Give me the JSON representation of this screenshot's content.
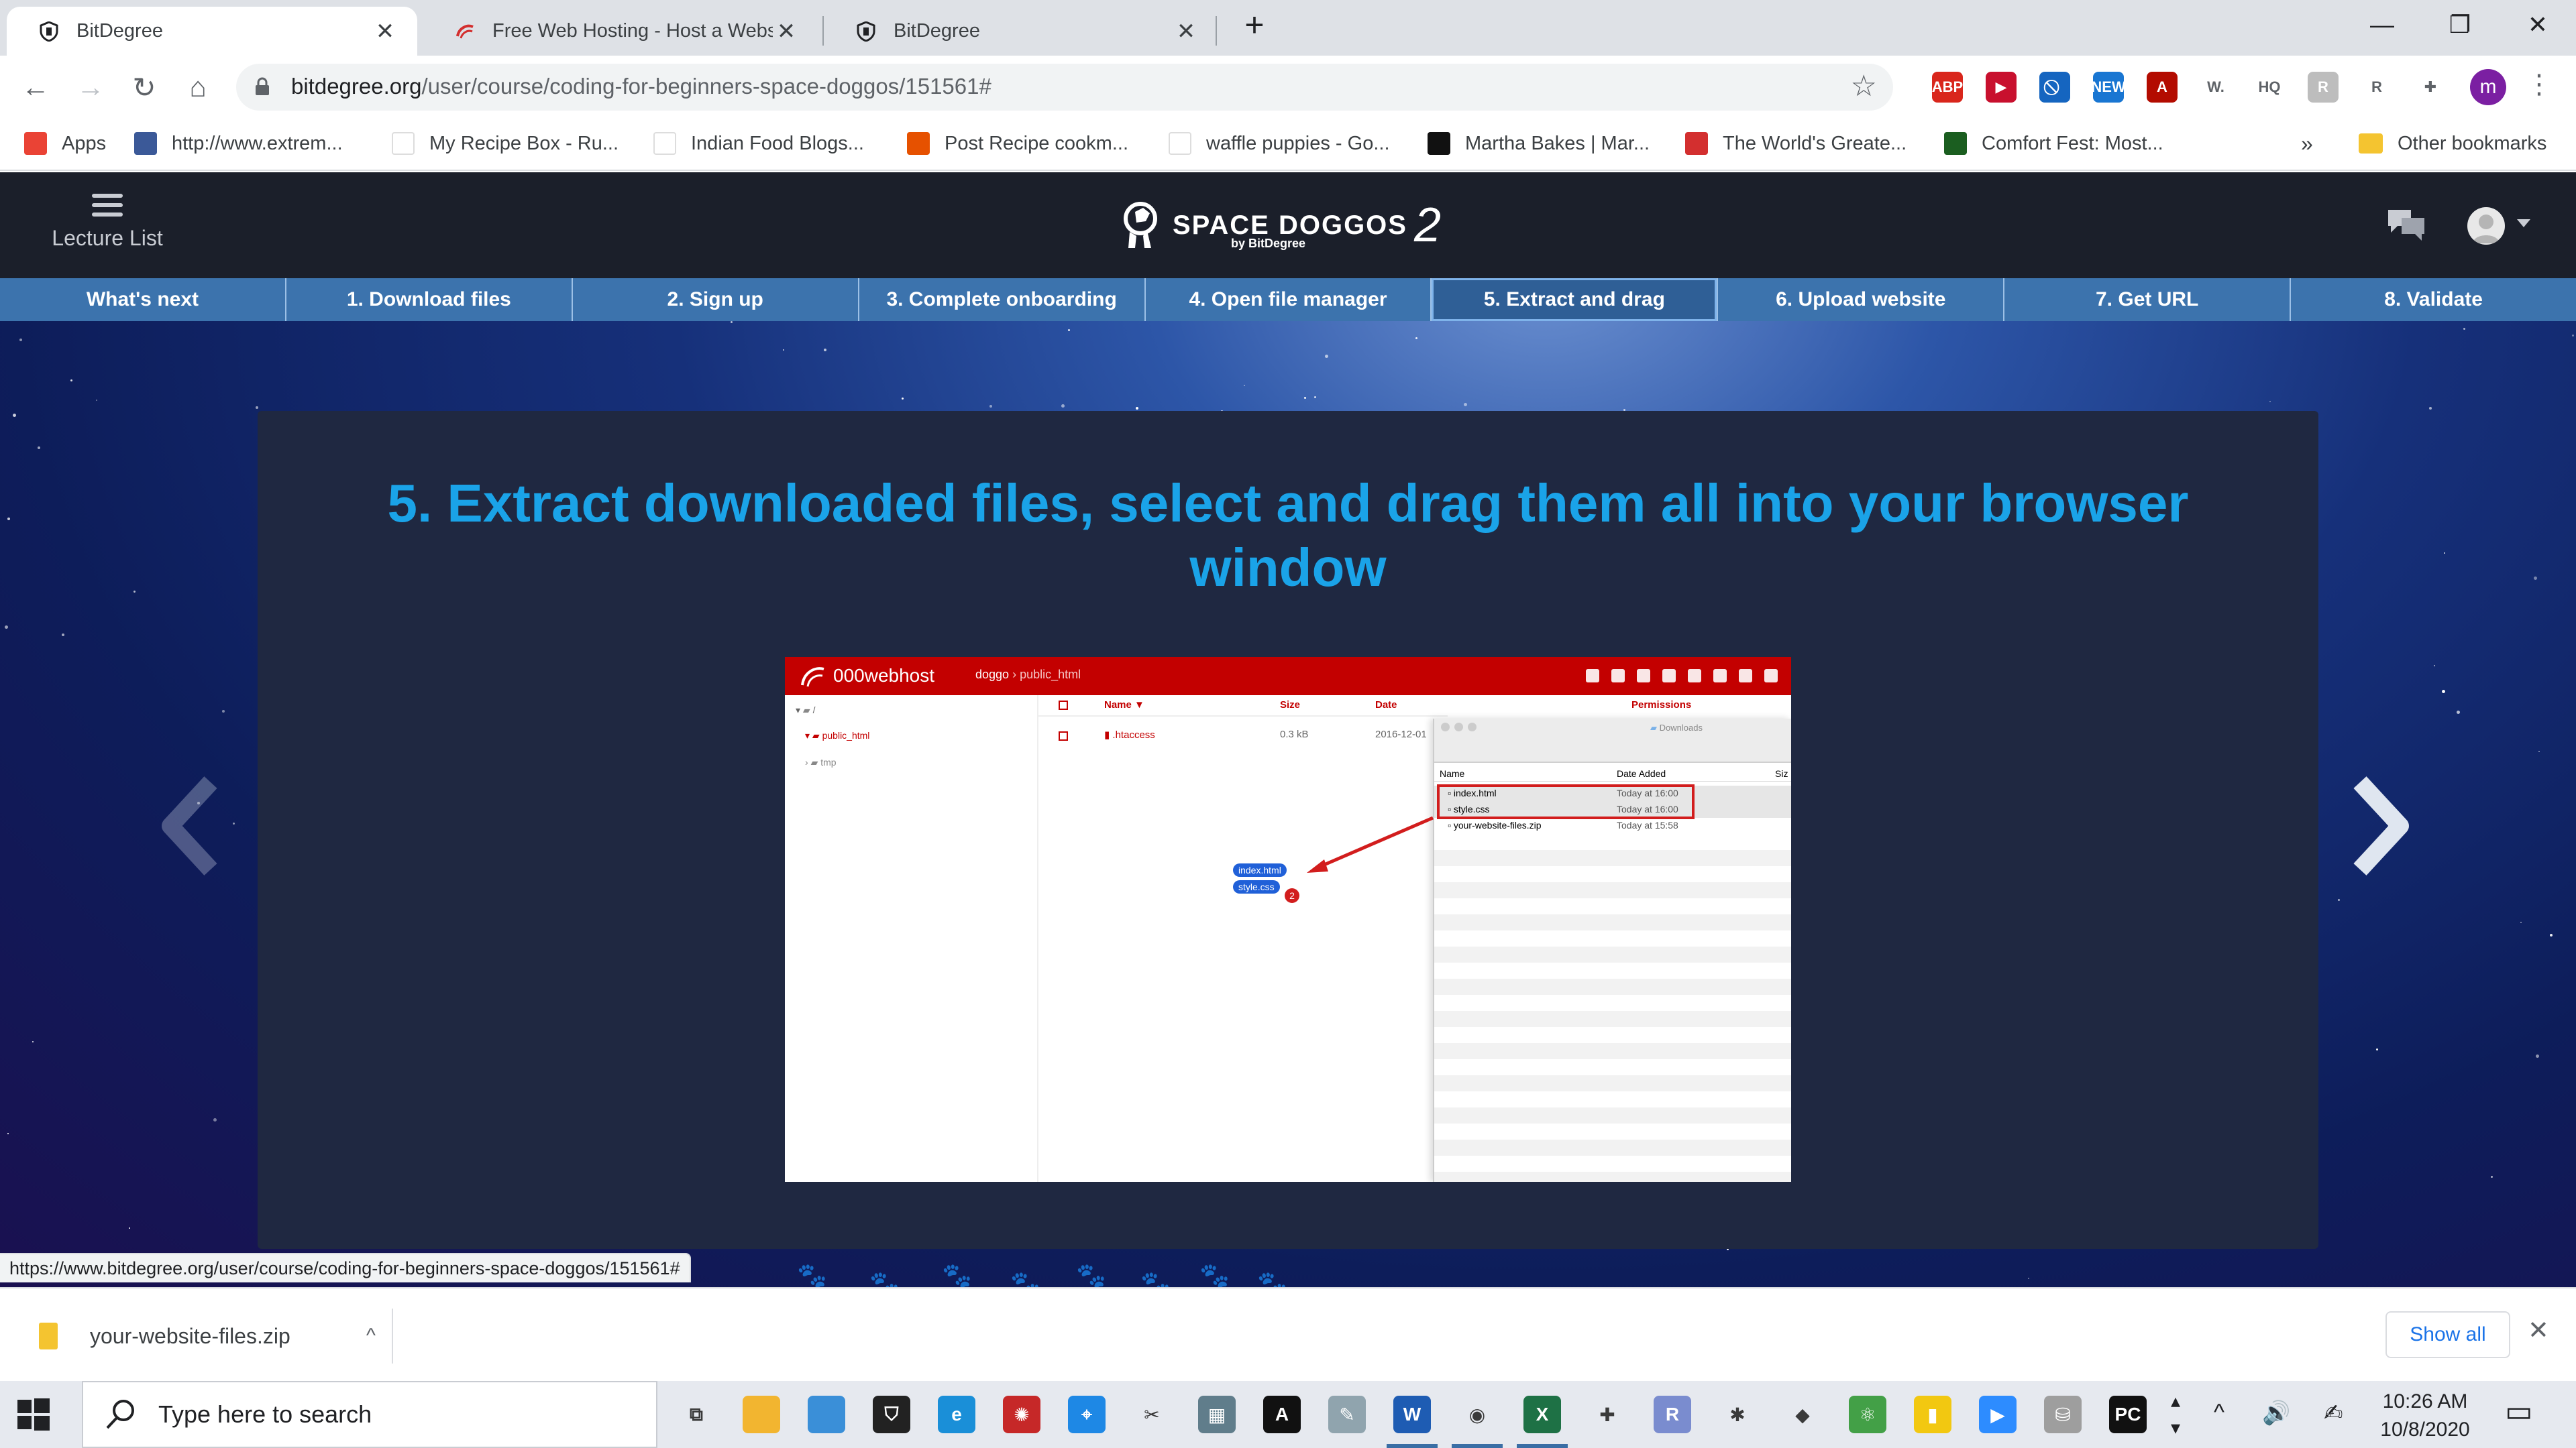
{
  "browser": {
    "tabs": [
      {
        "title": "BitDegree",
        "active": true
      },
      {
        "title": "Free Web Hosting - Host a Website",
        "active": false
      },
      {
        "title": "BitDegree",
        "active": false
      }
    ],
    "new_tab": "+",
    "window_controls": {
      "minimize": "—",
      "maximize": "❐",
      "close": "✕"
    }
  },
  "toolbar": {
    "back": "←",
    "forward": "→",
    "reload": "↻",
    "home": "⌂",
    "url_host": "bitdegree.org",
    "url_path": "/user/course/coding-for-beginners-space-doggos/151561#",
    "star": "☆",
    "extensions": [
      {
        "name": "abp-icon",
        "label": "ABP",
        "color": "#d9261c"
      },
      {
        "name": "readlater-icon",
        "label": "▶",
        "color": "#c8102e"
      },
      {
        "name": "block-icon",
        "label": "⃠",
        "color": "#1565c0"
      },
      {
        "name": "new-ext-icon",
        "label": "NEW",
        "color": "#1976d2"
      },
      {
        "name": "acrobat-icon",
        "label": "A",
        "color": "#b30b00"
      },
      {
        "name": "w-ext-icon",
        "label": "W.",
        "color": "#ffffff"
      },
      {
        "name": "cloudhq-icon",
        "label": "HQ",
        "color": "#ffffff"
      },
      {
        "name": "r-gray-icon",
        "label": "R",
        "color": "#bdbdbd"
      },
      {
        "name": "r-purple-icon",
        "label": "R",
        "color": "#ffffff"
      },
      {
        "name": "puzzle-icon",
        "label": "✚",
        "color": "#ffffff"
      }
    ],
    "profile_letter": "m",
    "menu": "⋮"
  },
  "bookmarks": {
    "items": [
      {
        "label": "Apps",
        "color": "#ea4335"
      },
      {
        "label": "http://www.extrem...",
        "color": "#3b5998"
      },
      {
        "label": "My Recipe Box - Ru...",
        "color": "#ffffff"
      },
      {
        "label": "Indian Food Blogs...",
        "color": "#ffffff"
      },
      {
        "label": "Post Recipe cookm...",
        "color": "#e65100"
      },
      {
        "label": "waffle puppies - Go...",
        "color": "#ffffff"
      },
      {
        "label": "Martha Bakes | Mar...",
        "color": "#111111"
      },
      {
        "label": "The World's Greate...",
        "color": "#d32f2f"
      },
      {
        "label": "Comfort Fest: Most...",
        "color": "#1b5e20"
      }
    ],
    "overflow": "»",
    "other": "Other bookmarks"
  },
  "site": {
    "lecture_list": "Lecture List",
    "logo_name": "SPACE DOGGOS",
    "logo_num": "2",
    "logo_by": "by BitDegree",
    "steps": [
      {
        "label": "What's next",
        "active": false
      },
      {
        "label": "1. Download files",
        "active": false
      },
      {
        "label": "2. Sign up",
        "active": false
      },
      {
        "label": "3. Complete onboarding",
        "active": false
      },
      {
        "label": "4. Open file manager",
        "active": false
      },
      {
        "label": "5. Extract and drag",
        "active": true
      },
      {
        "label": "6. Upload website",
        "active": false
      },
      {
        "label": "7. Get URL",
        "active": false
      },
      {
        "label": "8. Validate",
        "active": false
      }
    ],
    "lesson_title": "5. Extract downloaded files, select and drag them all into your browser window",
    "accent_color": "#1aa3e8",
    "screenshot": {
      "brand": "000webhost",
      "crumb_root": "doggo",
      "crumb_sep": "›",
      "crumb_leaf": "public_html",
      "tree": [
        {
          "label": "/"
        },
        {
          "label": "public_html"
        },
        {
          "label": "tmp"
        }
      ],
      "list_headers": {
        "name": "Name ▼",
        "size": "Size",
        "date": "Date",
        "perms": "Permissions"
      },
      "list_rows": [
        {
          "name": ".htaccess",
          "size": "0.3 kB",
          "date": "2016-12-01"
        }
      ],
      "finder_title": "Downloads",
      "finder_headers": {
        "name": "Name",
        "date": "Date Added",
        "size": "Siz"
      },
      "finder_rows": [
        {
          "name": "index.html",
          "date": "Today at 16:00"
        },
        {
          "name": "style.css",
          "date": "Today at 16:00"
        },
        {
          "name": "your-website-files.zip",
          "date": "Today at 15:58"
        }
      ],
      "drag_items": [
        "index.html",
        "style.css"
      ],
      "drag_count": "2"
    }
  },
  "status_url": "https://www.bitdegree.org/user/course/coding-for-beginners-space-doggos/151561#",
  "downloads": {
    "file": "your-website-files.zip",
    "caret": "^",
    "show_all": "Show all",
    "close": "✕"
  },
  "taskbar": {
    "search_placeholder": "Type here to search",
    "apps": [
      {
        "name": "task-view-icon",
        "color": "#e6e9ef",
        "label": "⧉"
      },
      {
        "name": "file-explorer-icon",
        "color": "#f2b530",
        "label": ""
      },
      {
        "name": "photos-icon",
        "color": "#3a8fd8",
        "label": ""
      },
      {
        "name": "store-icon",
        "color": "#222222",
        "label": "⛉"
      },
      {
        "name": "edge-icon",
        "color": "#1a8fd8",
        "label": "e"
      },
      {
        "name": "app-red-icon",
        "color": "#c62828",
        "label": "✺"
      },
      {
        "name": "safari-icon",
        "color": "#1e88e5",
        "label": "⌖"
      },
      {
        "name": "snip-icon",
        "color": "#e6e9ef",
        "label": "✂"
      },
      {
        "name": "calculator-icon",
        "color": "#607d8b",
        "label": "▦"
      },
      {
        "name": "acrobat-task-icon",
        "color": "#111111",
        "label": "A"
      },
      {
        "name": "pen-app-icon",
        "color": "#90a4ae",
        "label": "✎"
      },
      {
        "name": "word-icon",
        "color": "#1e5cb3",
        "label": "W"
      },
      {
        "name": "chrome-icon",
        "color": "#e6e9ef",
        "label": "◉"
      },
      {
        "name": "excel-icon",
        "color": "#1e7145",
        "label": "X"
      },
      {
        "name": "vscode-ext-icon",
        "color": "#e6e9ef",
        "label": "✚"
      },
      {
        "name": "r-app-icon",
        "color": "#7a8ccf",
        "label": "R"
      },
      {
        "name": "slack-icon",
        "color": "#e6e9ef",
        "label": "✱"
      },
      {
        "name": "git-icon",
        "color": "#e6e9ef",
        "label": "◆"
      },
      {
        "name": "atom-icon",
        "color": "#43a047",
        "label": "⚛"
      },
      {
        "name": "powerbi-icon",
        "color": "#f2c811",
        "label": "▮"
      },
      {
        "name": "zoom-icon",
        "color": "#2d8cff",
        "label": "▶"
      },
      {
        "name": "database-icon",
        "color": "#9e9e9e",
        "label": "⛁"
      },
      {
        "name": "pycharm-icon",
        "color": "#111111",
        "label": "PC"
      }
    ],
    "tray": {
      "chevron": "^",
      "volume": "🔊",
      "pen": "✍"
    },
    "time": "10:26 AM",
    "date": "10/8/2020",
    "notifications": "▭"
  }
}
